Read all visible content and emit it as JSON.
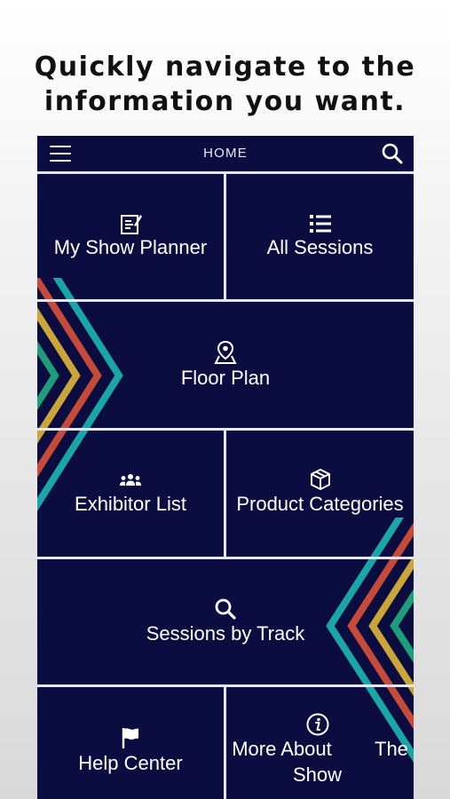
{
  "headline": {
    "line1": "Quickly navigate to the",
    "line2": "information you want."
  },
  "topbar": {
    "title": "HOME",
    "menu_icon": "hamburger-menu-icon",
    "search_icon": "search-icon"
  },
  "tiles": [
    {
      "label": "My Show Planner",
      "icon": "planner-icon"
    },
    {
      "label": "All Sessions",
      "icon": "list-icon"
    },
    {
      "label": "Floor Plan",
      "icon": "map-pin-icon"
    },
    {
      "label": "Exhibitor List",
      "icon": "people-icon"
    },
    {
      "label": "Product Categories",
      "icon": "box-icon"
    },
    {
      "label": "Sessions by Track",
      "icon": "search-icon"
    },
    {
      "label": "Help Center",
      "icon": "flag-icon"
    },
    {
      "label_line1": "More About",
      "label_line2": "Show",
      "icon": "info-icon"
    },
    {
      "label": "The"
    }
  ],
  "colors": {
    "background_navy": "#0b0c40",
    "divider": "#e6e6ee",
    "stripe_teal": "#1aa6a8",
    "stripe_red": "#c64a38",
    "stripe_gold": "#c9a53a",
    "stripe_green": "#1d9d7a"
  }
}
